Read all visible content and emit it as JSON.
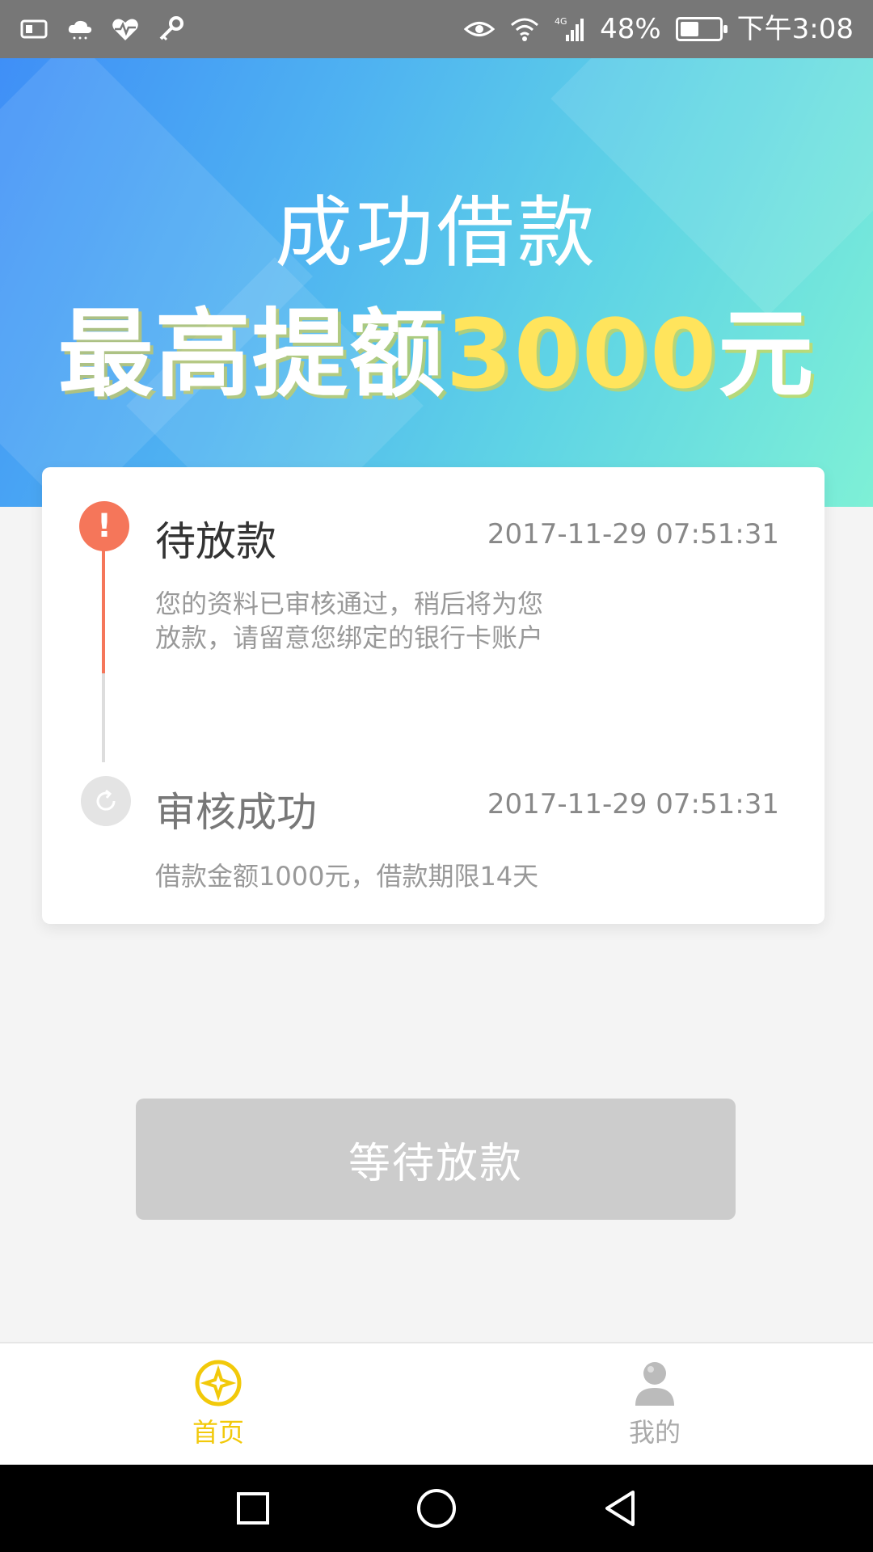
{
  "status_bar": {
    "battery_text": "48%",
    "battery_level": 0.48,
    "time": "下午3:08",
    "network": "4G",
    "icons": [
      "sim-icon",
      "cloud-icon",
      "heart-icon",
      "key-icon",
      "eye-icon",
      "wifi-icon",
      "signal-icon",
      "battery-icon"
    ]
  },
  "banner": {
    "title": "成功借款",
    "subtitle_prefix": "最高提额",
    "subtitle_amount": "3000",
    "subtitle_suffix": "元"
  },
  "timeline": {
    "steps": [
      {
        "title": "待放款",
        "time": "2017-11-29 07:51:31",
        "desc_line1": "您的资料已审核通过，稍后将为您",
        "desc_line2": "放款，请留意您绑定的银行卡账户",
        "status": "active",
        "icon": "exclamation-icon"
      },
      {
        "title": "审核成功",
        "time": "2017-11-29 07:51:31",
        "desc_line1": "借款金额1000元，借款期限14天",
        "status": "done",
        "icon": "refresh-icon"
      }
    ],
    "colors": {
      "active": "#f5765a",
      "inactive": "#e4e4e4"
    }
  },
  "action_button": {
    "label": "等待放款",
    "color": "#cccccc"
  },
  "bottom_nav": {
    "items": [
      {
        "label": "首页",
        "icon": "home-coin-icon",
        "active": true
      },
      {
        "label": "我的",
        "icon": "person-icon",
        "active": false
      }
    ],
    "active_color": "#f2c90a"
  },
  "system_nav": {
    "buttons": [
      "recent-apps-icon",
      "home-circle-icon",
      "back-triangle-icon"
    ]
  }
}
